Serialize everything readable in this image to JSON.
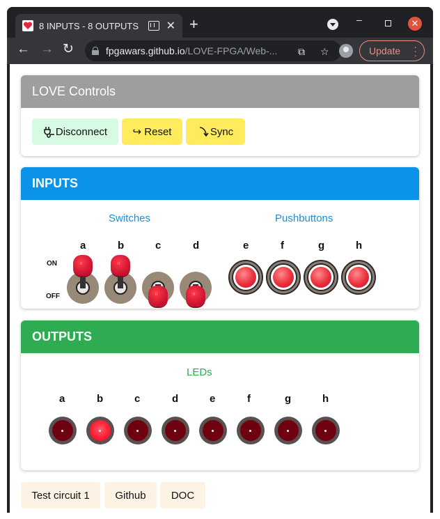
{
  "browser": {
    "tab_title": "8 INPUTS - 8 OUTPUTS",
    "tab_close": "✕",
    "new_tab": "+",
    "url_host": "fpgawars.github.io",
    "url_path": "/LOVE-FPGA/Web-...",
    "update_label": "Update"
  },
  "controls": {
    "title": "LOVE Controls",
    "disconnect_label": "Disconnect",
    "reset_label": "↪ Reset",
    "sync_label": "Sync"
  },
  "inputs": {
    "title": "INPUTS",
    "switches_label": "Switches",
    "pushbuttons_label": "Pushbuttons",
    "on_label": "ON",
    "off_label": "OFF",
    "switches": [
      {
        "label": "a",
        "state": "on"
      },
      {
        "label": "b",
        "state": "on"
      },
      {
        "label": "c",
        "state": "off"
      },
      {
        "label": "d",
        "state": "off"
      }
    ],
    "pushbuttons": [
      {
        "label": "e"
      },
      {
        "label": "f"
      },
      {
        "label": "g"
      },
      {
        "label": "h"
      }
    ]
  },
  "outputs": {
    "title": "OUTPUTS",
    "leds_label": "LEDs",
    "leds": [
      {
        "label": "a",
        "on": false
      },
      {
        "label": "b",
        "on": true
      },
      {
        "label": "c",
        "on": false
      },
      {
        "label": "d",
        "on": false
      },
      {
        "label": "e",
        "on": false
      },
      {
        "label": "f",
        "on": false
      },
      {
        "label": "g",
        "on": false
      },
      {
        "label": "h",
        "on": false
      }
    ]
  },
  "footer": {
    "test_circuit_label": "Test circuit 1",
    "github_label": "Github",
    "doc_label": "DOC"
  },
  "colors": {
    "controls_header": "#9e9e9e",
    "inputs_header": "#0a93e9",
    "outputs_header": "#2fab51",
    "disconnect_bg": "#d7fbe2",
    "reset_bg": "#ffeb5c"
  }
}
